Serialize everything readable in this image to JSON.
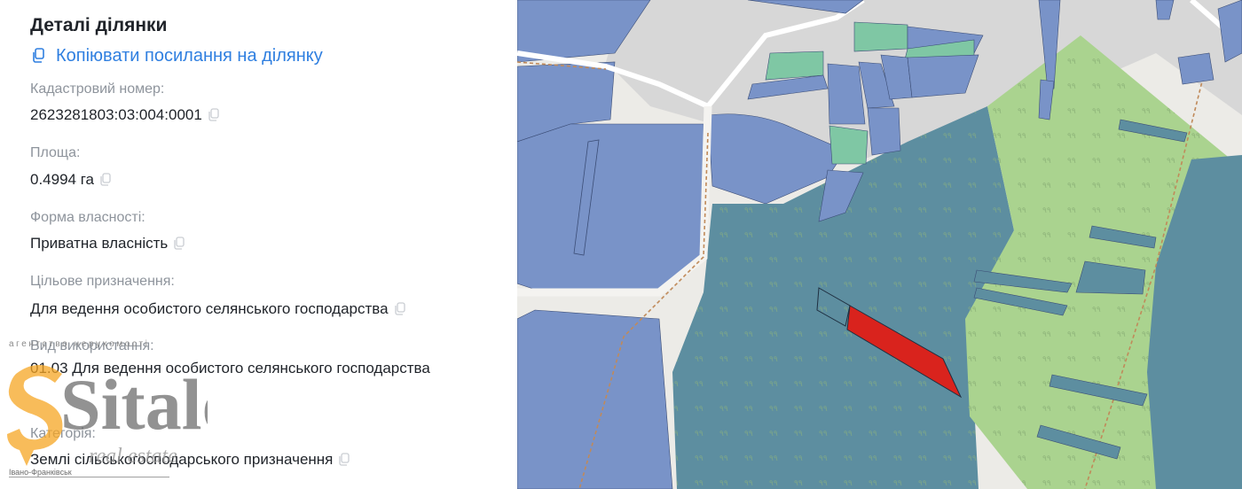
{
  "details": {
    "title": "Деталі ділянки",
    "copy_link_label": "Копіювати посилання на ділянку",
    "fields": [
      {
        "label": "Кадастровий номер:",
        "value": "2623281803:03:004:0001"
      },
      {
        "label": "Площа:",
        "value": "0.4994 га"
      },
      {
        "label": "Форма власності:",
        "value": "Приватна власність"
      },
      {
        "label": "Цільове призначення:",
        "value": "Для ведення особистого селянського господарства"
      },
      {
        "label": "Вид використання:",
        "value": "01.03 Для ведення особистого селянського господарства"
      },
      {
        "label": "Категорія:",
        "value": "Землі сільськогосподарського призначення"
      }
    ]
  },
  "watermark": {
    "top_text": "агентство нерухомості",
    "brand": "Sitalo",
    "tagline": "real estate",
    "city": "Івано-Франківськ"
  },
  "colors": {
    "link": "#2f7fe0",
    "selected_parcel": "#d9231d",
    "parcel_fill": "#6d8dc8",
    "forest": "#a9d18e",
    "pasture": "#7fc7a4"
  },
  "icons": {
    "copy": "copy-icon"
  }
}
